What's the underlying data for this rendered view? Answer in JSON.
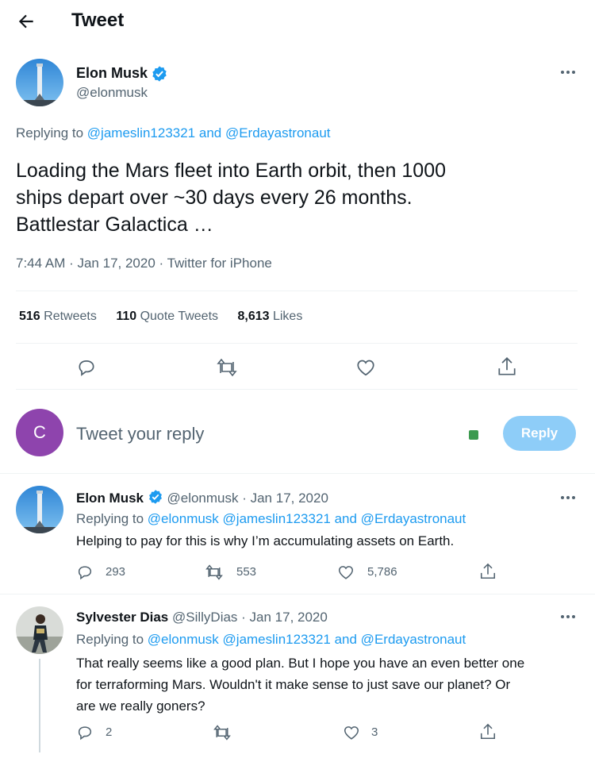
{
  "header": {
    "title": "Tweet",
    "back_icon": "back-arrow-icon"
  },
  "main_tweet": {
    "name": "Elon Musk",
    "handle": "@elonmusk",
    "replying_prefix": "Replying to",
    "replying_to": "@jameslin123321 and @Erdayastronaut",
    "text_line1": "Loading the Mars fleet into Earth orbit, then 1000",
    "text_line2": "ships depart over ~30 days every 26 months.",
    "text_line3": "Battlestar Galactica …",
    "meta": "7:44 AM · Jan 17, 2020 · Twitter for iPhone",
    "stats": {
      "retweets_count": "516",
      "retweets_label": "Retweets",
      "quotes_count": "110",
      "quotes_label": "Quote Tweets",
      "likes_count": "8,613",
      "likes_label": "Likes"
    }
  },
  "compose": {
    "avatar_letter": "C",
    "avatar_color": "#8e44ad",
    "placeholder": "Tweet your reply",
    "reply_button": "Reply"
  },
  "replies": [
    {
      "name": "Elon Musk",
      "handle_date": "@elonmusk · Jan 17, 2020",
      "replying_prefix": "Replying to",
      "replying_to": "@elonmusk @jameslin123321 and @Erdayastronaut",
      "text_line1": "Helping to pay for this is why I’m accumulating assets on Earth.",
      "replies_count": "293",
      "retweets_count": "553",
      "likes_count": "5,786"
    },
    {
      "name": "Sylvester Dias",
      "handle_date": "@SillyDias · Jan 17, 2020",
      "replying_prefix": "Replying to",
      "replying_to": "@elonmusk @jameslin123321 and @Erdayastronaut",
      "text_line1": "That really seems like a good plan. But I hope you have an even better one",
      "text_line2": "for terraforming Mars. Wouldn't it make sense to just save our planet? Or",
      "text_line3": "are we really goners?",
      "replies_count": "2",
      "retweets_count": "",
      "likes_count": "3"
    }
  ],
  "colors": {
    "accent": "#1d9bf0",
    "reply_button_disabled": "#8ecdf8",
    "gray_text": "#536471"
  }
}
